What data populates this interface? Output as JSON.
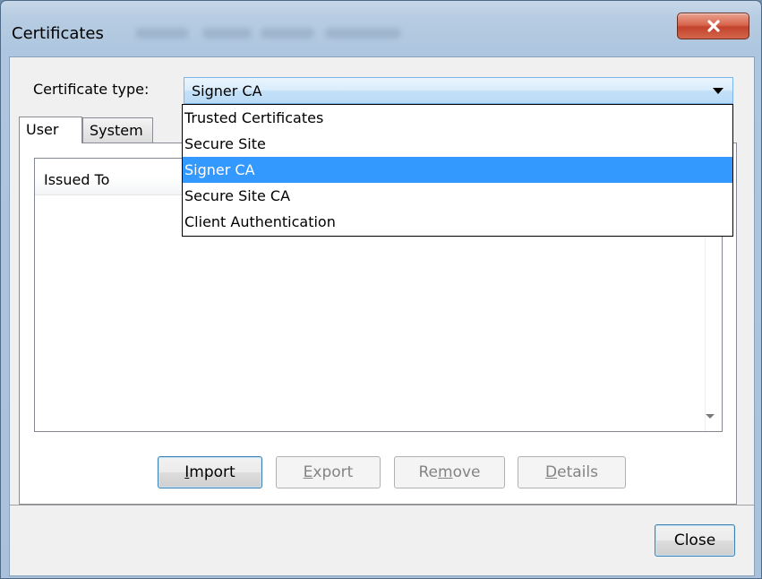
{
  "window": {
    "title": "Certificates",
    "close_icon": "close-x-icon"
  },
  "form": {
    "type_label": "Certificate type:",
    "selected_type": "Signer CA"
  },
  "dropdown": {
    "options": [
      "Trusted Certificates",
      "Secure Site",
      "Signer CA",
      "Secure Site CA",
      "Client Authentication"
    ],
    "selected_index": 2
  },
  "tabs": [
    {
      "label": "User",
      "active": true
    },
    {
      "label": "System",
      "active": false
    }
  ],
  "table": {
    "columns": [
      "Issued To"
    ]
  },
  "buttons": {
    "import": {
      "pre": "",
      "mnemonic": "I",
      "post": "mport",
      "enabled": true
    },
    "export": {
      "pre": "",
      "mnemonic": "E",
      "post": "xport",
      "enabled": false
    },
    "remove": {
      "pre": "Re",
      "mnemonic": "m",
      "post": "ove",
      "enabled": false
    },
    "details": {
      "pre": "",
      "mnemonic": "D",
      "post": "etails",
      "enabled": false
    },
    "close": "Close"
  },
  "colors": {
    "selection": "#3399ff",
    "close_button": "#c7432d"
  }
}
